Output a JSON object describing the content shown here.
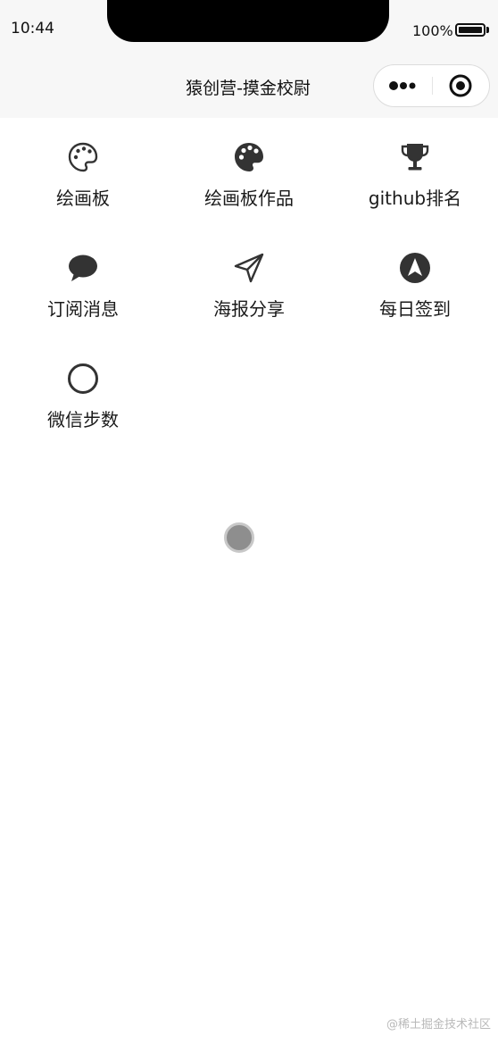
{
  "status_bar": {
    "time": "10:44",
    "battery_percent": "100%",
    "battery_level": 1.0
  },
  "nav": {
    "title": "猿创营-摸金校尉"
  },
  "menu": [
    {
      "label": "绘画板",
      "icon": "palette-outline-icon"
    },
    {
      "label": "绘画板作品",
      "icon": "palette-icon"
    },
    {
      "label": "github排名",
      "icon": "trophy-icon"
    },
    {
      "label": "订阅消息",
      "icon": "chat-bubble-icon"
    },
    {
      "label": "海报分享",
      "icon": "paper-plane-icon"
    },
    {
      "label": "每日签到",
      "icon": "navigation-arrow-icon"
    },
    {
      "label": "微信步数",
      "icon": "circle-outline-icon"
    }
  ],
  "watermark": "@稀土掘金技术社区",
  "colors": {
    "nav_background": "#f7f7f7",
    "icon": "#333333",
    "loading": "#8e8e8e"
  }
}
